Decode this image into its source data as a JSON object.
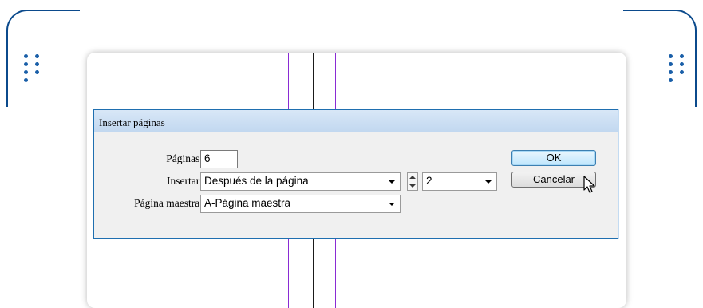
{
  "dialog": {
    "title": "Insertar páginas",
    "fields": {
      "paginas_label": "Páginas:",
      "paginas_value": "6",
      "insertar_label": "Insertar:",
      "insertar_value": "Después de la página",
      "pagina_numero_value": "2",
      "maestra_label": "Página maestra:",
      "maestra_value": "A-Página maestra"
    },
    "buttons": {
      "ok": "OK",
      "cancel": "Cancelar"
    }
  },
  "colors": {
    "frame": "#0b4a8c",
    "guide_purple": "#8a2bd4",
    "guide_black": "#1a1a1a",
    "dialog_border": "#1f6fb0"
  }
}
